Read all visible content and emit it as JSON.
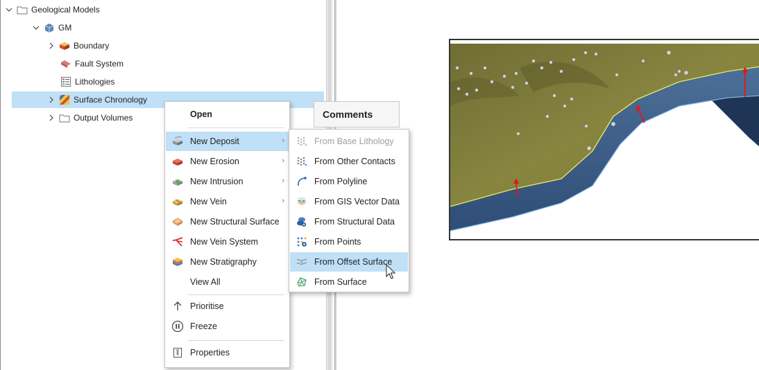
{
  "tree": {
    "items": [
      {
        "label": "Geological Models",
        "expanded": true,
        "icon": "folder-icon"
      },
      {
        "label": "GM",
        "expanded": true,
        "icon": "geological-model-icon"
      },
      {
        "label": "Boundary",
        "expanded": false,
        "icon": "boundary-icon"
      },
      {
        "label": "Fault System",
        "icon": "fault-system-icon"
      },
      {
        "label": "Lithologies",
        "icon": "lithologies-icon"
      },
      {
        "label": "Surface Chronology",
        "expanded": false,
        "icon": "surface-chronology-icon",
        "selected": true
      },
      {
        "label": "Output Volumes",
        "expanded": false,
        "icon": "folder-icon"
      }
    ]
  },
  "comments_header": "Comments",
  "context_menu": {
    "open": "Open",
    "new_deposit": "New Deposit",
    "new_erosion": "New Erosion",
    "new_intrusion": "New Intrusion",
    "new_vein": "New Vein",
    "new_structural_surface": "New Structural Surface",
    "new_vein_system": "New Vein System",
    "new_stratigraphy": "New Stratigraphy",
    "view_all": "View All",
    "prioritise": "Prioritise",
    "freeze": "Freeze",
    "properties": "Properties"
  },
  "submenu": {
    "from_base_lithology": "From Base Lithology",
    "from_other_contacts": "From Other Contacts",
    "from_polyline": "From Polyline",
    "from_gis_vector_data": "From GIS Vector Data",
    "from_structural_data": "From Structural Data",
    "from_points": "From Points",
    "from_offset_surface": "From Offset Surface",
    "from_surface": "From Surface"
  },
  "colors": {
    "selection": "#bfe0f6",
    "surface_top": "#7f7d3c",
    "surface_side": "#3d5d86",
    "arrow": "#e01818"
  }
}
